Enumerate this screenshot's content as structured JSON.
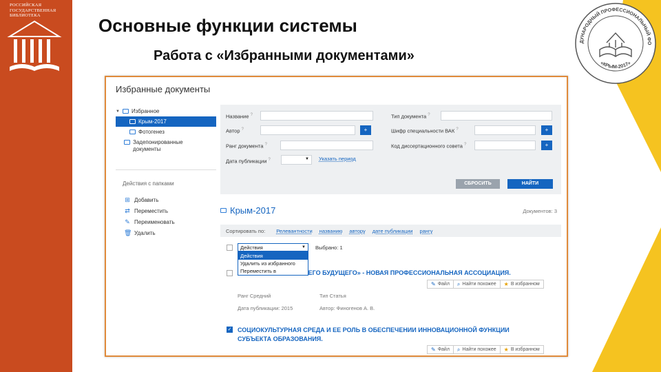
{
  "logo": {
    "lines": [
      "РОССИЙСКАЯ",
      "ГОСУДАРСТВЕННАЯ",
      "БИБЛИОТЕКА"
    ]
  },
  "seal": {
    "top": "МЕЖДУНАРОДНЫЙ ПРОФЕССИОНАЛЬНЫЙ ФОРУМ",
    "bottom": "«КРЫМ-2017»"
  },
  "slide": {
    "title": "Основные функции системы",
    "subtitle": "Работа с «Избранными документами»"
  },
  "colors": {
    "accent": "#1565c0",
    "band": "#c94b1f",
    "yellow": "#f5c320"
  },
  "app": {
    "page_title": "Избранные документы",
    "tree": [
      {
        "label": "Избранное",
        "icon": "folder-icon",
        "selected": false
      },
      {
        "label": "Крым-2017",
        "icon": "folder-icon",
        "selected": true
      },
      {
        "label": "Фотогенез",
        "icon": "folder-icon",
        "selected": false
      },
      {
        "label": "Задепонированные документы",
        "icon": "folder-icon",
        "selected": false
      }
    ],
    "folder_actions": {
      "heading": "Действия с папками",
      "items": [
        {
          "label": "Добавить",
          "icon": "folder-plus-icon"
        },
        {
          "label": "Переместить",
          "icon": "move-icon"
        },
        {
          "label": "Переименовать",
          "icon": "pencil-icon"
        },
        {
          "label": "Удалить",
          "icon": "trash-icon"
        }
      ]
    },
    "filters": {
      "name": "Название",
      "author": "Автор",
      "rank": "Ранг документа",
      "pub_date": "Дата публикации",
      "doc_type": "Тип документа",
      "vak_code": "Шифр специальности ВАК",
      "council_code": "Код диссертационного совета",
      "period_link": "Указать период",
      "reset": "СБРОСИТЬ",
      "find": "НАЙТИ"
    },
    "collection": {
      "title": "Крым-2017",
      "count": "Документов: 3"
    },
    "sort": {
      "label": "Сортировать по:",
      "options": [
        "Релевантности",
        "названию",
        "автору",
        "дате публикации",
        "рангу"
      ]
    },
    "actions_dropdown": {
      "value": "Действия",
      "options": [
        "Действия",
        "Удалить из избранного",
        "Переместить в"
      ]
    },
    "selected_count": "Выбрано: 1",
    "documents": [
      {
        "title": "…ОЛЬШЕГО БУДУЩЕГО» - НОВАЯ ПРОФЕССИОНАЛЬНАЯ АССОЦИАЦИЯ.",
        "rank": "Ранг Средний",
        "type": "Тип Статья",
        "date": "Дата публикации: 2015",
        "author": "Автор: Финогенов А. В.",
        "checked": false
      },
      {
        "title_line1": "СОЦИОКУЛЬТУРНАЯ СРЕДА И ЕЕ РОЛЬ В ОБЕСПЕЧЕНИИ ИННОВАЦИОННОЙ ФУНКЦИИ",
        "title_line2": "СУБЪЕКТА ОБРАЗОВАНИЯ.",
        "checked": true
      }
    ],
    "doc_tools": {
      "file": "Файл",
      "similar": "Найти похожее",
      "favorite": "В избранном"
    }
  }
}
